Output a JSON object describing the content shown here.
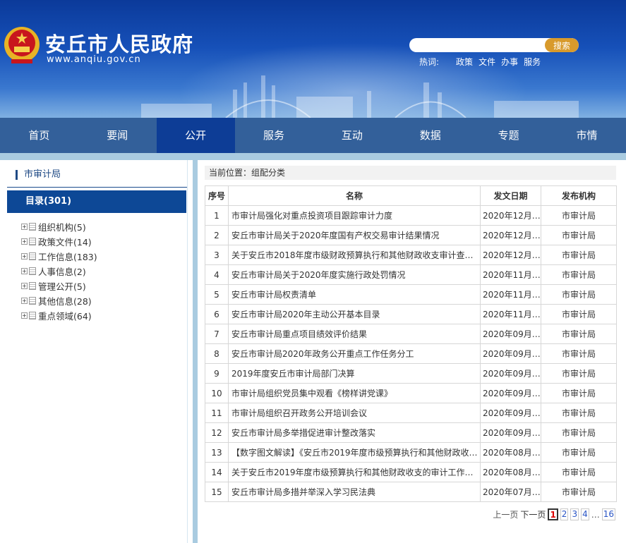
{
  "header": {
    "site_title": "安丘市人民政府",
    "site_domain": "www.anqiu.gov.cn",
    "search": {
      "placeholder": "",
      "button_label": "搜索"
    },
    "hot_label": "热词:",
    "hot_words": [
      "政策",
      "文件",
      "办事",
      "服务"
    ]
  },
  "nav": {
    "items": [
      "首页",
      "要闻",
      "公开",
      "服务",
      "互动",
      "数据",
      "专题",
      "市情"
    ],
    "active": "公开"
  },
  "sidebar": {
    "dept_title": "市审计局",
    "catalog_label": "目录(301)",
    "tree": [
      "组织机构(5)",
      "政策文件(14)",
      "工作信息(183)",
      "人事信息(2)",
      "管理公开(5)",
      "其他信息(28)",
      "重点领域(64)"
    ]
  },
  "main": {
    "breadcrumb": "当前位置：组配分类",
    "columns": [
      "序号",
      "名称",
      "发文日期",
      "发布机构"
    ],
    "rows": [
      [
        "1",
        "市审计局强化对重点投资项目跟踪审计力度",
        "2020年12月…",
        "市审计局"
      ],
      [
        "2",
        "安丘市审计局关于2020年度国有产权交易审计结果情况",
        "2020年12月…",
        "市审计局"
      ],
      [
        "3",
        "关于安丘市2018年度市级财政预算执行和其他财政收支审计查出…",
        "2020年12月…",
        "市审计局"
      ],
      [
        "4",
        "安丘市审计局关于2020年度实施行政处罚情况",
        "2020年11月…",
        "市审计局"
      ],
      [
        "5",
        "安丘市审计局权责清单",
        "2020年11月…",
        "市审计局"
      ],
      [
        "6",
        "安丘市审计局2020年主动公开基本目录",
        "2020年11月…",
        "市审计局"
      ],
      [
        "7",
        "安丘市审计局重点项目绩效评价结果",
        "2020年09月…",
        "市审计局"
      ],
      [
        "8",
        "安丘市审计局2020年政务公开重点工作任务分工",
        "2020年09月…",
        "市审计局"
      ],
      [
        "9",
        "2019年度安丘市审计局部门决算",
        "2020年09月…",
        "市审计局"
      ],
      [
        "10",
        "市审计局组织党员集中观看《榜样讲党课》",
        "2020年09月…",
        "市审计局"
      ],
      [
        "11",
        "市审计局组织召开政务公开培训会议",
        "2020年09月…",
        "市审计局"
      ],
      [
        "12",
        "安丘市审计局多举措促进审计整改落实",
        "2020年09月…",
        "市审计局"
      ],
      [
        "13",
        "【数字图文解读】《安丘市2019年度市级预算执行和其他财政收…",
        "2020年08月…",
        "市审计局"
      ],
      [
        "14",
        "关于安丘市2019年度市级预算执行和其他财政收支的审计工作报…",
        "2020年08月…",
        "市审计局"
      ],
      [
        "15",
        "安丘市审计局多措并举深入学习民法典",
        "2020年07月…",
        "市审计局"
      ]
    ],
    "pager": {
      "prev": "上一页",
      "next": "下一页",
      "pages": [
        "1",
        "2",
        "3",
        "4"
      ],
      "ellipsis": "…",
      "last": "16",
      "current": "1"
    }
  },
  "colors": {
    "nav_bg": "#33609a",
    "nav_active": "#0d3d96",
    "catalog_bg": "#0d4896",
    "search_button": "#d89a2c"
  }
}
